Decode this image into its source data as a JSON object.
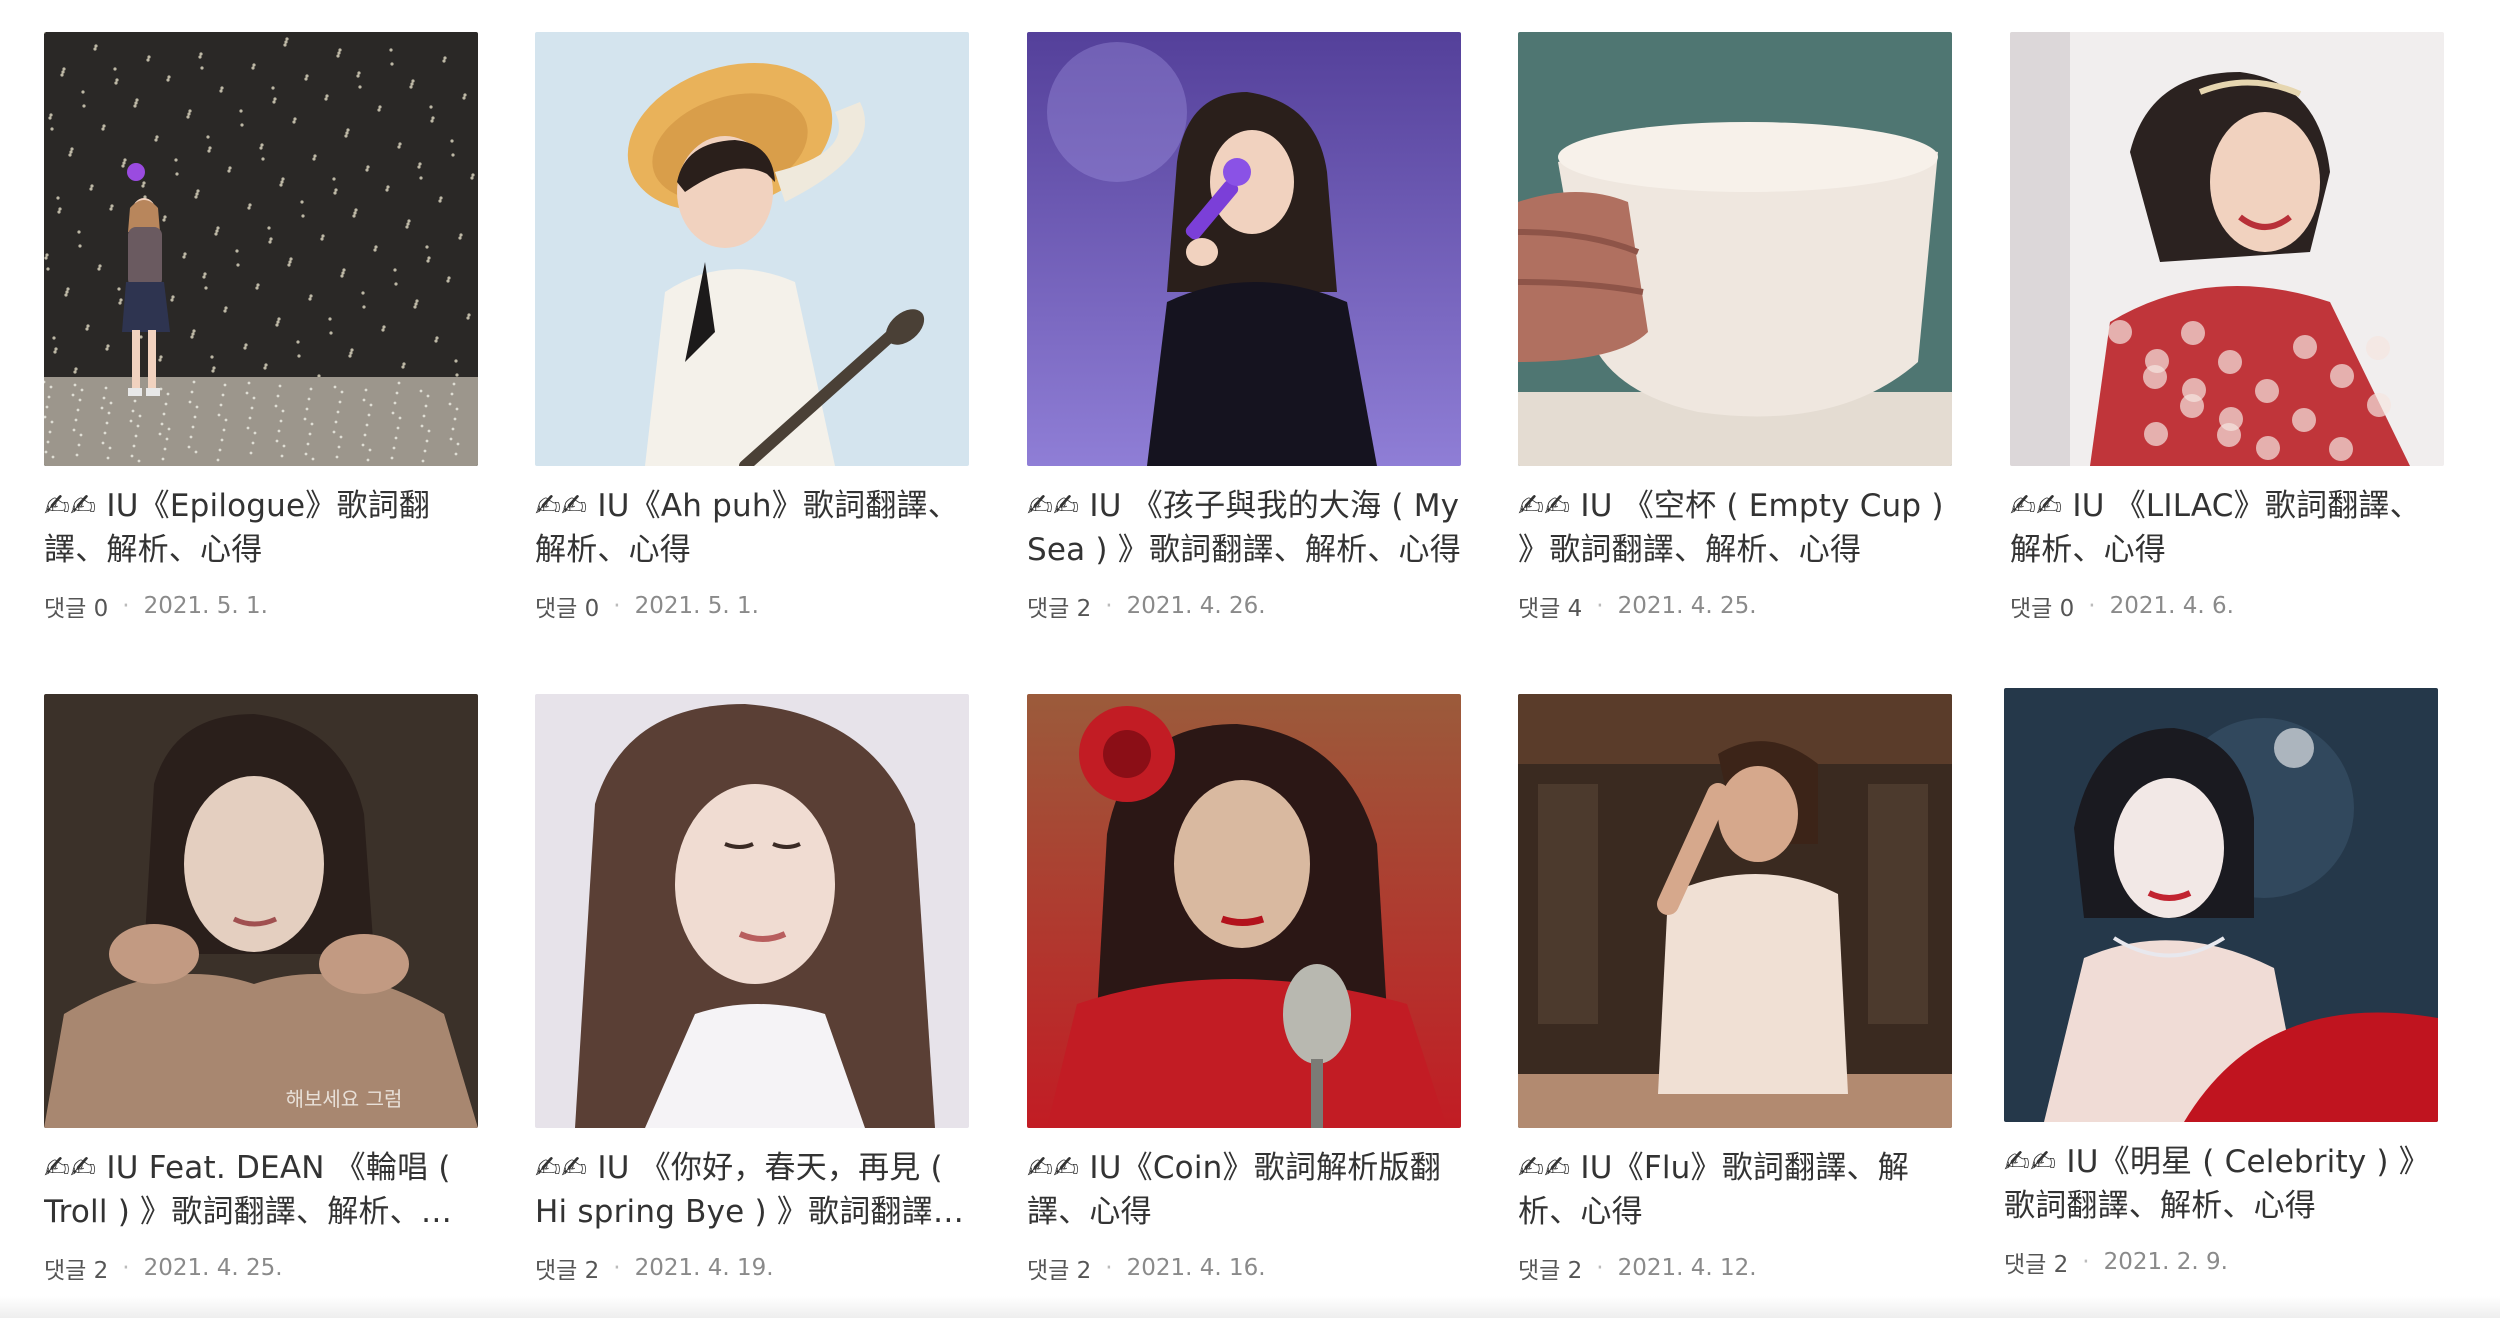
{
  "posts": [
    {
      "title": "✍✍ IU《Epilogue》歌詞翻譯、解析、心得",
      "comments": "댓글 0",
      "date": "2021. 5. 1.",
      "image": {
        "kind": "concert-stage",
        "colors": [
          "#2a2826",
          "#6a5a60",
          "#efe8d0"
        ]
      }
    },
    {
      "title": "✍✍ IU《Ah puh》歌詞翻譯、解析、心得",
      "comments": "댓글 0",
      "date": "2021. 5. 1.",
      "image": {
        "kind": "straw-hat-portrait",
        "colors": [
          "#d4e4ee",
          "#e9b25a",
          "#f4f1ea"
        ]
      }
    },
    {
      "title": "✍✍ IU 《孩子與我的大海 ( My Sea ) 》歌詞翻譯、解析、心得",
      "comments": "댓글 2",
      "date": "2021. 4. 26.",
      "image": {
        "kind": "purple-concert",
        "colors": [
          "#54409a",
          "#8f7ed6",
          "#15131f"
        ]
      }
    },
    {
      "title": "✍✍ IU 《空杯 ( Empty Cup ) 》歌詞翻譯、解析、心得",
      "comments": "댓글 4",
      "date": "2021. 4. 25.",
      "image": {
        "kind": "teacup",
        "colors": [
          "#4f7672",
          "#efe7df",
          "#b07060"
        ]
      }
    },
    {
      "title": "✍✍ IU 《LILAC》歌詞翻譯、解析、心得",
      "comments": "댓글 0",
      "date": "2021. 4. 6.",
      "image": {
        "kind": "lilac-portrait",
        "colors": [
          "#f1eeee",
          "#c0353a",
          "#2b2220"
        ]
      }
    },
    {
      "title": "✍✍ IU Feat. DEAN 《輪唱 ( Troll ) 》歌詞翻譯、解析、心得",
      "comments": "댓글 2",
      "date": "2021. 4. 25.",
      "image": {
        "kind": "sweater-portrait",
        "colors": [
          "#3b3129",
          "#a88770",
          "#e4cfc0"
        ],
        "caption": "해보세요 그럼"
      }
    },
    {
      "title": "✍✍ IU 《你好，春天，再見 ( Hi spring Bye ) 》歌詞翻譯、解析、心得",
      "comments": "댓글 2",
      "date": "2021. 4. 19.",
      "image": {
        "kind": "long-hair-portrait",
        "colors": [
          "#e7e3ea",
          "#5a3f35",
          "#f0dcd2"
        ]
      }
    },
    {
      "title": "✍✍ IU《Coin》歌詞解析版翻譯、心得",
      "comments": "댓글 2",
      "date": "2021. 4. 16.",
      "image": {
        "kind": "red-flower-mic",
        "colors": [
          "#9b5b3b",
          "#c21c24",
          "#d9b9a0"
        ]
      }
    },
    {
      "title": "✍✍ IU《Flu》歌詞翻譯、解析、心得",
      "comments": "댓글 2",
      "date": "2021. 4. 12.",
      "image": {
        "kind": "stage-dance",
        "colors": [
          "#3a2a20",
          "#d6a88c",
          "#f0e0d4"
        ]
      }
    },
    {
      "title": "✍✍ IU《明星 ( Celebrity ) 》歌詞翻譯、解析、心得",
      "comments": "댓글 2",
      "date": "2021. 2. 9.",
      "image": {
        "kind": "red-dress-portrait",
        "colors": [
          "#25384a",
          "#c0141f",
          "#f2e8e6"
        ]
      }
    }
  ]
}
